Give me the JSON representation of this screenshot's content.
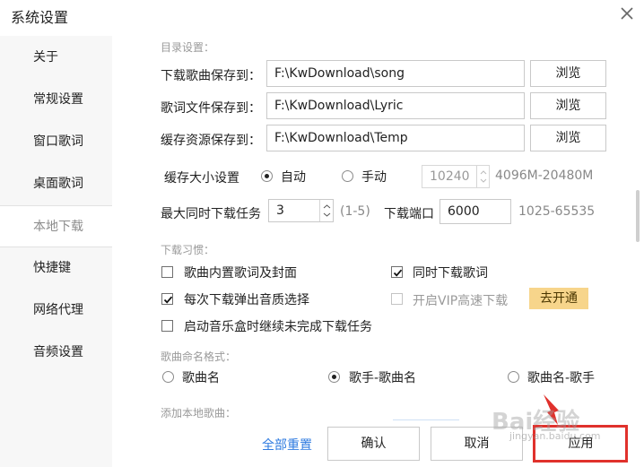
{
  "window": {
    "title": "系统设置"
  },
  "sidebar": {
    "items": [
      {
        "label": "关于"
      },
      {
        "label": "常规设置"
      },
      {
        "label": "窗口歌词"
      },
      {
        "label": "桌面歌词"
      },
      {
        "label": "本地下载"
      },
      {
        "label": "快捷键"
      },
      {
        "label": "网络代理"
      },
      {
        "label": "音频设置"
      }
    ],
    "active": "本地下载"
  },
  "dirs": {
    "section_title": "目录设置：",
    "song_label": "下载歌曲保存到：",
    "song_value": "F:\\KwDownload\\song",
    "lyric_label": "歌词文件保存到：",
    "lyric_value": "F:\\KwDownload\\Lyric",
    "cache_label": "缓存资源保存到：",
    "cache_value": "F:\\KwDownload\\Temp",
    "browse_label": "浏览"
  },
  "cache": {
    "label": "缓存大小设置",
    "auto_label": "自动",
    "manual_label": "手动",
    "size_value": "10240",
    "range_hint": "4096M-20480M",
    "selected": "自动"
  },
  "tasks": {
    "label": "最大同时下载任务",
    "value": "3",
    "range_hint": "(1-5)",
    "port_label": "下载端口",
    "port_value": "6000",
    "port_hint": "1025-65535"
  },
  "habits": {
    "section_title": "下载习惯：",
    "embed_lyrics": {
      "label": "歌曲内置歌词及封面",
      "checked": false
    },
    "sync_lyrics": {
      "label": "同时下载歌词",
      "checked": true
    },
    "quality_popup": {
      "label": "每次下载弹出音质选择",
      "checked": true
    },
    "vip_speed": {
      "label": "开启VIP高速下载",
      "checked": false,
      "disabled": true
    },
    "vip_button": "去开通",
    "resume_tasks": {
      "label": "启动音乐盒时继续未完成下载任务",
      "checked": false
    }
  },
  "naming": {
    "section_title": "歌曲命名格式：",
    "opt1": "歌曲名",
    "opt2": "歌手-歌曲名",
    "opt3": "歌曲名-歌手",
    "selected": "歌手-歌曲名"
  },
  "add_local": {
    "section_title": "添加本地歌曲："
  },
  "footer": {
    "reset_label": "全部重置",
    "ok_label": "确认",
    "cancel_label": "取消",
    "apply_label": "应用"
  },
  "watermark": {
    "text": "Bai经验",
    "sub": "jingyan.baidu.com"
  },
  "colors": {
    "accent": "#2f7be0",
    "vip_bg": "#f7d58b",
    "highlight": "#e0312c"
  }
}
